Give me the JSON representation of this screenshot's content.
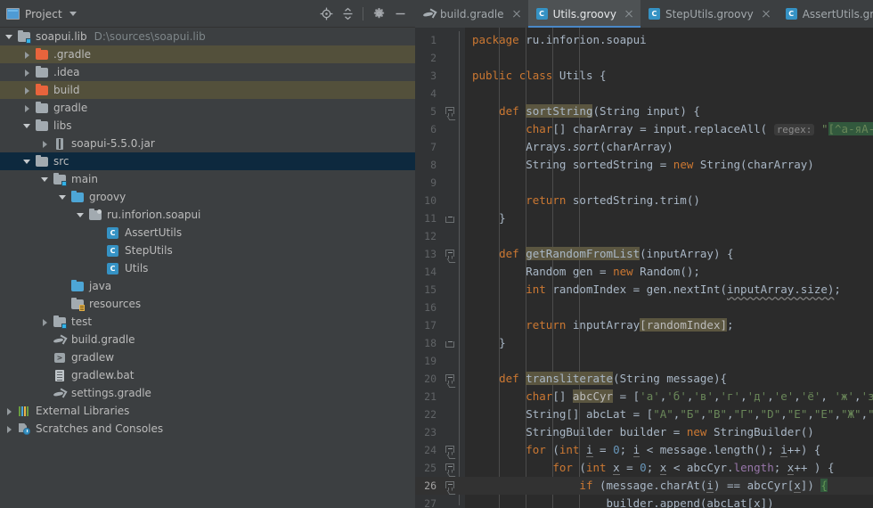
{
  "project_panel": {
    "title": "Project",
    "window_icon": "project-window-icon",
    "dropdown_icon": "chevron-down-icon",
    "toolbar": [
      {
        "name": "locate-icon",
        "label": "Select Opened File"
      },
      {
        "name": "collapse-all-icon",
        "label": "Collapse All"
      },
      {
        "name": "gear-icon",
        "label": "Settings"
      },
      {
        "name": "minimize-icon",
        "label": "Hide"
      }
    ],
    "tree": [
      {
        "label": "soapui.lib",
        "secondary": "D:\\sources\\soapui.lib",
        "indent": 0,
        "arrow": "down",
        "icon": "module-folder-icon",
        "state": "normal"
      },
      {
        "label": ".gradle",
        "indent": 1,
        "arrow": "right",
        "icon": "folder-excluded-icon",
        "state": "ignored"
      },
      {
        "label": ".idea",
        "indent": 1,
        "arrow": "right",
        "icon": "folder-icon",
        "state": "normal"
      },
      {
        "label": "build",
        "indent": 1,
        "arrow": "right",
        "icon": "folder-excluded-icon",
        "state": "ignored"
      },
      {
        "label": "gradle",
        "indent": 1,
        "arrow": "right",
        "icon": "folder-icon",
        "state": "normal"
      },
      {
        "label": "libs",
        "indent": 1,
        "arrow": "down",
        "icon": "folder-icon",
        "state": "normal"
      },
      {
        "label": "soapui-5.5.0.jar",
        "indent": 2,
        "arrow": "right",
        "icon": "jar-icon",
        "state": "normal"
      },
      {
        "label": "src",
        "indent": 1,
        "arrow": "down",
        "icon": "folder-icon",
        "state": "selected"
      },
      {
        "label": "main",
        "indent": 2,
        "arrow": "down",
        "icon": "source-module-folder-icon",
        "state": "normal"
      },
      {
        "label": "groovy",
        "indent": 3,
        "arrow": "down",
        "icon": "source-root-folder-icon",
        "state": "normal"
      },
      {
        "label": "ru.inforion.soapui",
        "indent": 4,
        "arrow": "down",
        "icon": "package-icon",
        "state": "normal"
      },
      {
        "label": "AssertUtils",
        "indent": 5,
        "arrow": "none",
        "icon": "groovy-class-icon",
        "state": "normal"
      },
      {
        "label": "StepUtils",
        "indent": 5,
        "arrow": "none",
        "icon": "groovy-class-icon",
        "state": "normal"
      },
      {
        "label": "Utils",
        "indent": 5,
        "arrow": "none",
        "icon": "groovy-class-icon",
        "state": "normal"
      },
      {
        "label": "java",
        "indent": 3,
        "arrow": "none",
        "icon": "source-root-folder-icon",
        "state": "normal"
      },
      {
        "label": "resources",
        "indent": 3,
        "arrow": "none",
        "icon": "resources-root-folder-icon",
        "state": "normal"
      },
      {
        "label": "test",
        "indent": 2,
        "arrow": "right",
        "icon": "source-module-folder-icon",
        "state": "normal"
      },
      {
        "label": "build.gradle",
        "indent": 2,
        "arrow": "none",
        "icon": "gradle-file-icon",
        "state": "normal"
      },
      {
        "label": "gradlew",
        "indent": 2,
        "arrow": "none",
        "icon": "shell-script-icon",
        "state": "normal"
      },
      {
        "label": "gradlew.bat",
        "indent": 2,
        "arrow": "none",
        "icon": "batch-file-icon",
        "state": "normal"
      },
      {
        "label": "settings.gradle",
        "indent": 2,
        "arrow": "none",
        "icon": "gradle-file-icon",
        "state": "normal"
      },
      {
        "label": "External Libraries",
        "indent": 0,
        "arrow": "right",
        "icon": "external-libraries-icon",
        "state": "normal"
      },
      {
        "label": "Scratches and Consoles",
        "indent": 0,
        "arrow": "right",
        "icon": "scratches-icon",
        "state": "normal"
      }
    ]
  },
  "editor": {
    "tabs": [
      {
        "label": "build.gradle",
        "icon": "gradle-file-icon",
        "active": false
      },
      {
        "label": "Utils.groovy",
        "icon": "groovy-class-icon",
        "active": true
      },
      {
        "label": "StepUtils.groovy",
        "icon": "groovy-class-icon",
        "active": false
      },
      {
        "label": "AssertUtils.groovy",
        "icon": "groovy-class-icon",
        "active": false
      }
    ],
    "accent_color": "#4A88C7",
    "caret_line": 26,
    "lines": [
      {
        "n": 1,
        "fold": "none"
      },
      {
        "n": 2,
        "fold": "none"
      },
      {
        "n": 3,
        "fold": "none"
      },
      {
        "n": 4,
        "fold": "none"
      },
      {
        "n": 5,
        "fold": "start"
      },
      {
        "n": 6,
        "fold": "none"
      },
      {
        "n": 7,
        "fold": "none"
      },
      {
        "n": 8,
        "fold": "none"
      },
      {
        "n": 9,
        "fold": "none"
      },
      {
        "n": 10,
        "fold": "none"
      },
      {
        "n": 11,
        "fold": "end"
      },
      {
        "n": 12,
        "fold": "none"
      },
      {
        "n": 13,
        "fold": "start"
      },
      {
        "n": 14,
        "fold": "none"
      },
      {
        "n": 15,
        "fold": "none"
      },
      {
        "n": 16,
        "fold": "none"
      },
      {
        "n": 17,
        "fold": "none"
      },
      {
        "n": 18,
        "fold": "end"
      },
      {
        "n": 19,
        "fold": "none"
      },
      {
        "n": 20,
        "fold": "start"
      },
      {
        "n": 21,
        "fold": "none"
      },
      {
        "n": 22,
        "fold": "none"
      },
      {
        "n": 23,
        "fold": "none"
      },
      {
        "n": 24,
        "fold": "start"
      },
      {
        "n": 25,
        "fold": "start"
      },
      {
        "n": 26,
        "fold": "start"
      },
      {
        "n": 27,
        "fold": "none"
      }
    ],
    "code_text": [
      "package ru.inforion.soapui",
      "",
      "public class Utils {",
      "",
      "    def sortString(String input) {",
      "        char[] charArray = input.replaceAll( regex: \"[^а-яА-Яa-zA-",
      "        Arrays.sort(charArray)",
      "        String sortedString = new String(charArray)",
      "",
      "        return sortedString.trim()",
      "    }",
      "",
      "    def getRandomFromList(inputArray) {",
      "        Random gen = new Random();",
      "        int randomIndex = gen.nextInt(inputArray.size);",
      "",
      "        return inputArray[randomIndex];",
      "    }",
      "",
      "    def transliterate(String message){",
      "        char[] abcCyr = ['а','б','в','г','д','е','ё', 'ж','з','и",
      "        String[] abcLat = [\"A\",\"Б\",\"B\",\"Г\",\"D\",\"E\",\"E\",\"Ж\",\"З\",\"И",
      "        StringBuilder builder = new StringBuilder()",
      "        for (int i = 0; i < message.length(); i++) {",
      "            for (int x = 0; x < abcCyr.length; x++ ) {",
      "                if (message.charAt(i) == abcCyr[x]) {",
      "                    builder.append(abcLat[x])"
    ],
    "parameter_hints": [
      "regex:"
    ],
    "highlighted_identifiers": [
      "sortString",
      "getRandomFromList",
      "transliterate",
      "abcCyr",
      "randomIndex"
    ]
  },
  "theme": {
    "panel_bg": "#3C3F41",
    "editor_bg": "#2B2B2B",
    "gutter_bg": "#313335",
    "selection_bg": "#0D293E",
    "ignored_bg": "#53503B",
    "caret_line_bg": "#323232",
    "text_fg": "#BBBBBB",
    "code_fg": "#A9B7C6",
    "keyword": "#CC7832",
    "string": "#6A8759",
    "number": "#6897BB",
    "field": "#9876AA"
  }
}
